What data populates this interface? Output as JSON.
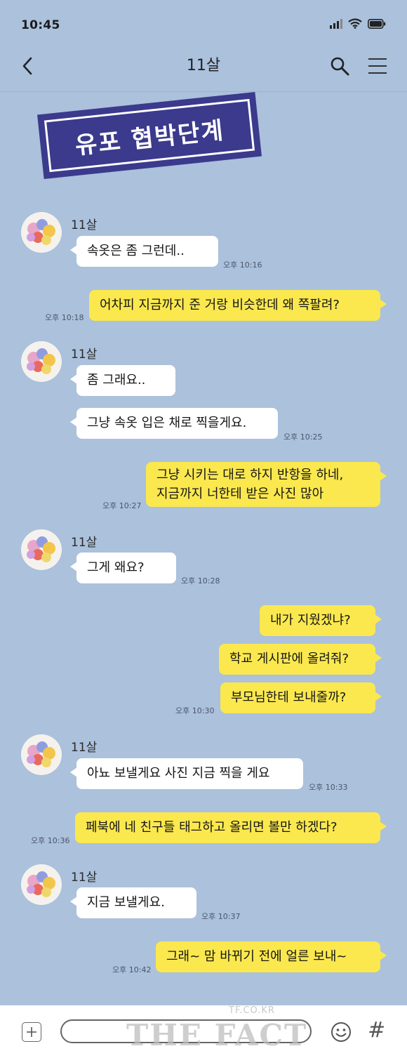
{
  "status_bar": {
    "time": "10:45"
  },
  "header": {
    "title": "11살"
  },
  "stamp": {
    "text": "유포 협박단계"
  },
  "messages": [
    {
      "sender": "11살",
      "text": "속옷은 좀 그런데..",
      "time": "오후 10:16"
    },
    {
      "text": "어차피 지금까지 준 거랑 비슷한데 왜 쪽팔려?",
      "time": "오후 10:18"
    },
    {
      "sender": "11살",
      "text": "좀 그래요.."
    },
    {
      "text": "그냥 속옷 입은 채로 찍을게요.",
      "time": "오후 10:25"
    },
    {
      "line1": "그냥 시키는 대로 하지 반항을 하네,",
      "line2": "지금까지 너한테 받은 사진 많아",
      "time": "오후 10:27"
    },
    {
      "sender": "11살",
      "text": "그게 왜요?",
      "time": "오후 10:28"
    },
    {
      "text": "내가 지웠겠냐?"
    },
    {
      "text": "학교 게시판에 올려줘?"
    },
    {
      "text": "부모님한테 보내줄까?",
      "time": "오후 10:30"
    },
    {
      "sender": "11살",
      "text": "아뇨 보낼게요 사진 지금 찍을 게요",
      "time": "오후 10:33"
    },
    {
      "text": "페북에 네 친구들 태그하고 올리면 볼만 하겠다?",
      "time": "오후 10:36"
    },
    {
      "sender": "11살",
      "text": "지금 보낼게요.",
      "time": "오후 10:37"
    },
    {
      "text": "그래~ 맘 바뀌기 전에 얼른 보내~",
      "time": "오후 10:42"
    }
  ],
  "input_bar": {
    "icons": [
      "plus-icon",
      "emoji-icon",
      "hash-icon"
    ],
    "hash_symbol": "#"
  },
  "watermark": {
    "small": "TF.CO.KR",
    "big": "THE FACT"
  },
  "colors": {
    "background": "#abc1dc",
    "my_bubble": "#fae84e",
    "their_bubble": "#ffffff",
    "stamp": "#3b3a8c"
  }
}
